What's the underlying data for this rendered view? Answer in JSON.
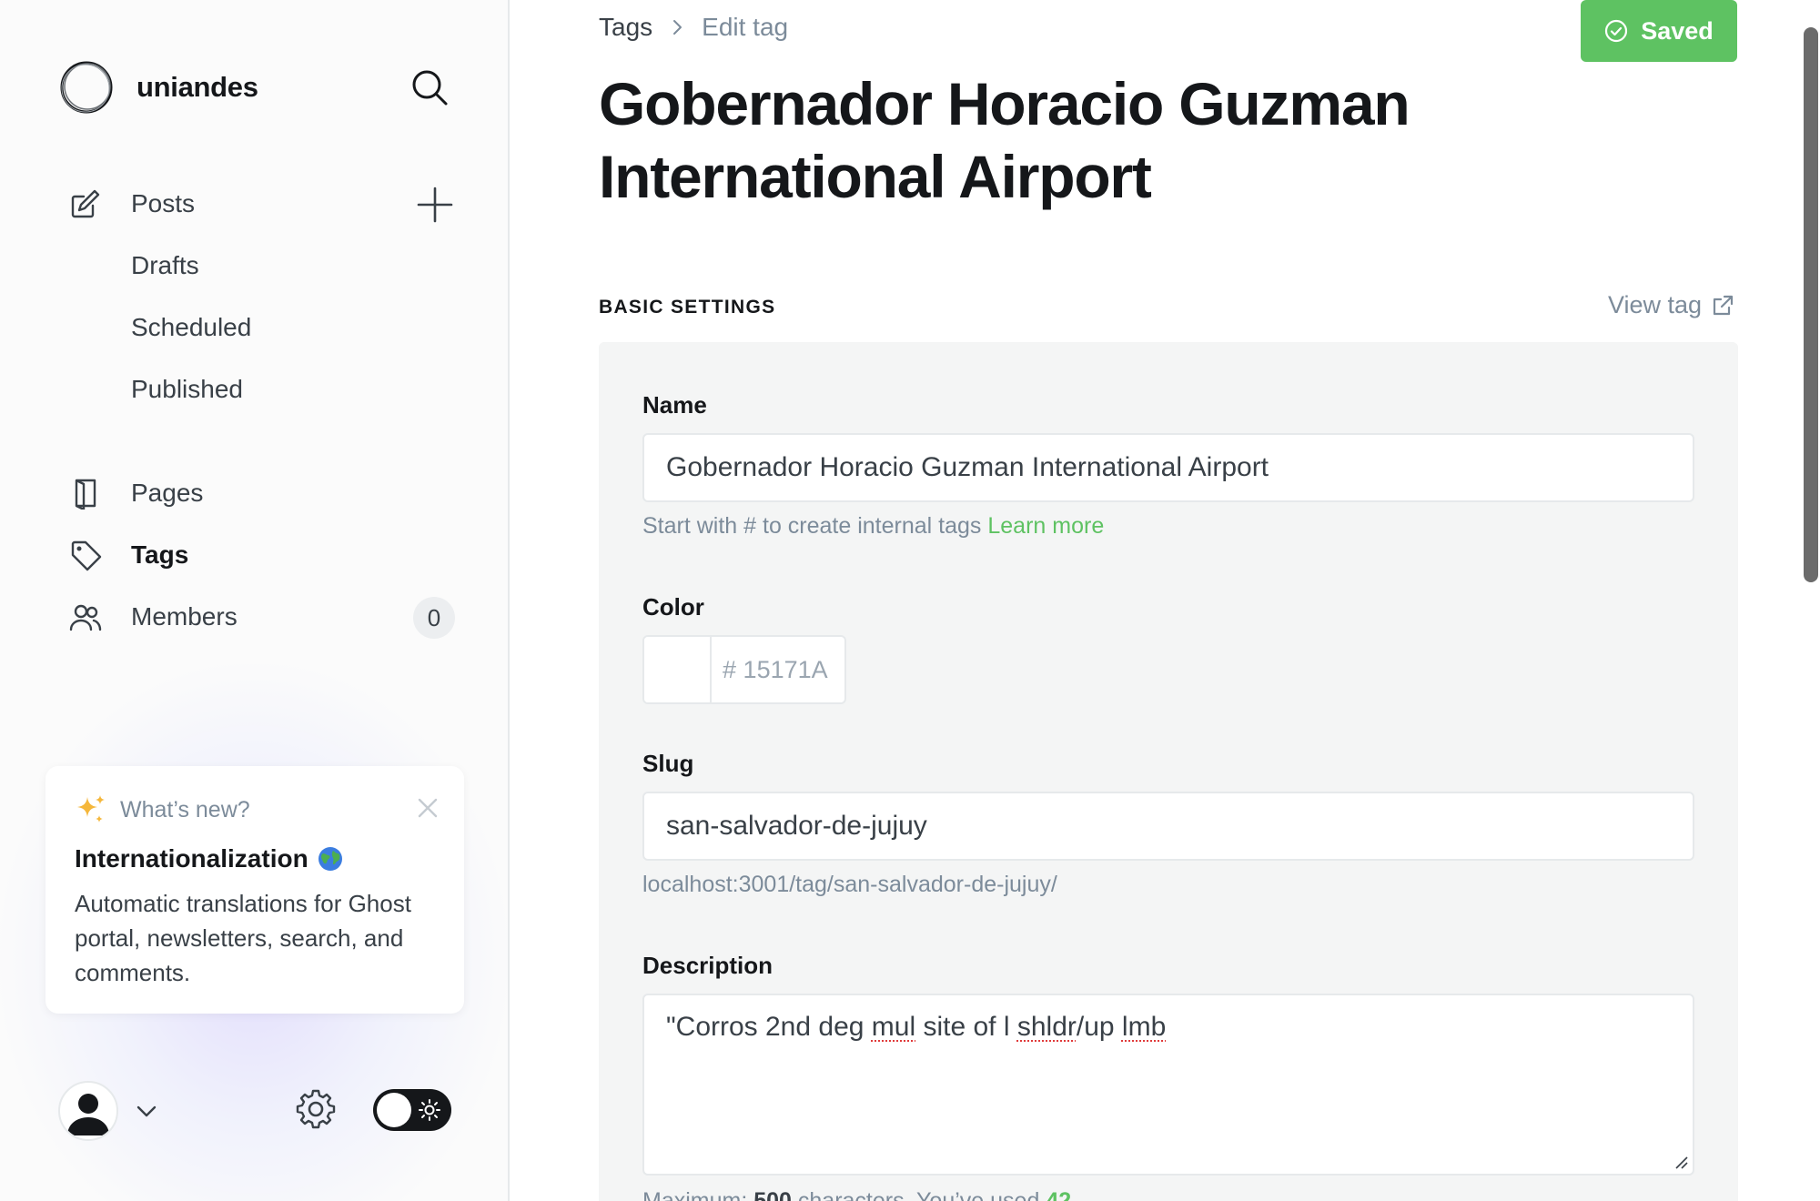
{
  "brand": {
    "name": "uniandes"
  },
  "nav": {
    "posts": "Posts",
    "drafts": "Drafts",
    "scheduled": "Scheduled",
    "published": "Published",
    "pages": "Pages",
    "tags": "Tags",
    "members": "Members",
    "members_count": "0"
  },
  "whats_new": {
    "kicker": "What’s new?",
    "title": "Internationalization",
    "body": "Automatic translations for Ghost portal, newsletters, search, and comments."
  },
  "header": {
    "breadcrumb_root": "Tags",
    "breadcrumb_current": "Edit tag",
    "saved_label": "Saved",
    "title": "Gobernador Horacio Guzman International Airport"
  },
  "basic_settings": {
    "heading": "BASIC SETTINGS",
    "view_tag": "View tag",
    "name_label": "Name",
    "name_value": "Gobernador Horacio Guzman International Airport",
    "name_hint": "Start with # to create internal tags",
    "name_hint_link": "Learn more",
    "color_label": "Color",
    "color_hash": "#",
    "color_value": "15171A",
    "slug_label": "Slug",
    "slug_value": "san-salvador-de-jujuy",
    "slug_url": "localhost:3001/tag/san-salvador-de-jujuy/",
    "description_label": "Description",
    "description_parts": [
      "\"Corros 2nd deg ",
      "mul",
      " site of l ",
      "shldr",
      "/up ",
      "lmb"
    ],
    "max_prefix": "Maximum: ",
    "max_value": "500",
    "max_suffix": " characters. You’ve used ",
    "used_value": "42"
  },
  "colors": {
    "accent_green": "#5ec262",
    "text_dark": "#15171a",
    "text_muted": "#7c8b9a",
    "panel_bg": "#f4f5f5"
  },
  "icons": {
    "search": "search-icon",
    "posts": "edit-icon",
    "add": "plus-icon",
    "pages": "page-icon",
    "tags": "tag-icon",
    "members": "members-icon",
    "sparkle": "sparkle-icon",
    "close": "close-icon",
    "gear": "gear-icon",
    "theme": "sun-icon",
    "check": "check-circle-icon",
    "external": "external-link-icon"
  }
}
